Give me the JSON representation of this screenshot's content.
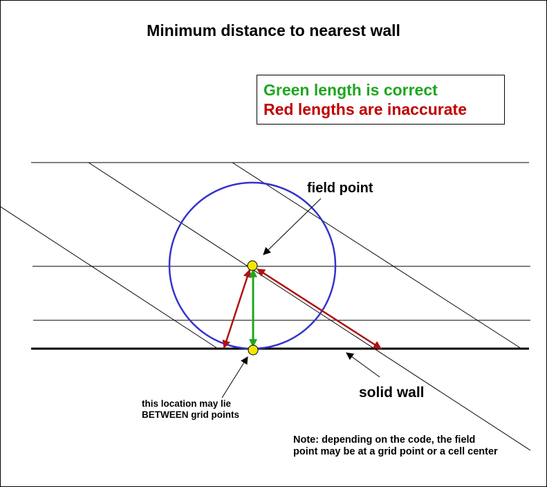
{
  "title": "Minimum distance to nearest wall",
  "legend": {
    "correct": "Green length is correct",
    "inaccurate": "Red lengths are inaccurate"
  },
  "labels": {
    "field_point": "field point",
    "solid_wall": "solid wall",
    "between_line1": "this location may lie",
    "between_line2": "BETWEEN grid points",
    "note_line1": "Note: depending on the code, the field",
    "note_line2": "point may be at a grid point or a cell center"
  },
  "colors": {
    "correct": "#1fa61f",
    "inaccurate": "#b01010",
    "circle": "#3333cc",
    "point_fill": "#f2e600"
  }
}
